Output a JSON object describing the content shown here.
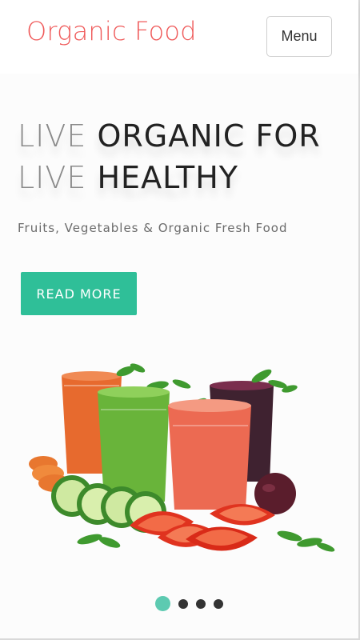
{
  "header": {
    "logo": "Organic Food",
    "menu_label": "Menu"
  },
  "hero": {
    "headline": {
      "line1_light": "LIVE",
      "line1_dark": "ORGANIC FOR",
      "line2_light": "LIVE",
      "line2_dark": "HEALTHY"
    },
    "subtitle": "Fruits, Vegetables & Organic Fresh Food",
    "cta_label": "READ MORE",
    "image_icon": "juice-vegetables-photo"
  },
  "carousel": {
    "slide_count": 4,
    "active_index": 0
  },
  "colors": {
    "brand": "#ef5a5a",
    "accent": "#2fbf98",
    "active_dot": "#5dcab1"
  }
}
